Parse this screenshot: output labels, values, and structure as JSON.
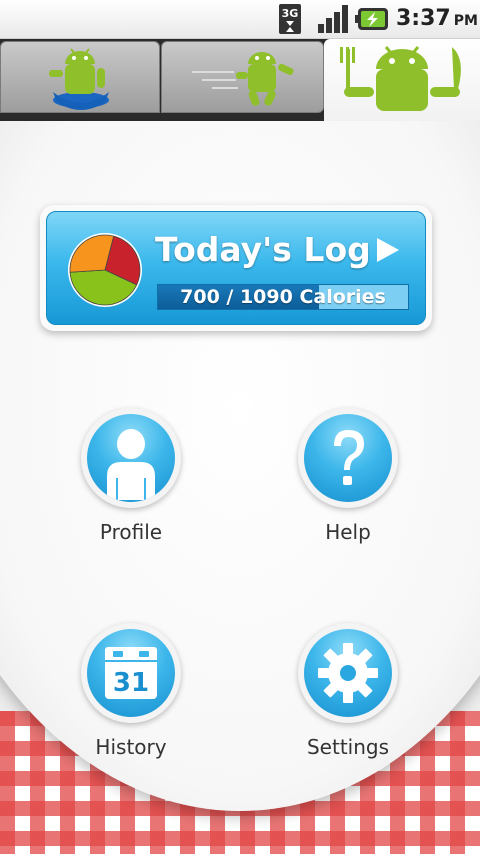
{
  "status_bar": {
    "network": "3G",
    "time": "3:37",
    "ampm": "PM"
  },
  "tabs": [
    {
      "name": "tab-weight",
      "icon": "android-on-scale-icon"
    },
    {
      "name": "tab-exercise",
      "icon": "android-running-icon"
    },
    {
      "name": "tab-food",
      "icon": "android-fork-knife-icon",
      "selected": true
    }
  ],
  "todays_log": {
    "title": "Today's Log",
    "calories_consumed": 700,
    "calories_goal": 1090,
    "calories_text": "700 / 1090 Calories",
    "pie_segments": [
      {
        "label": "red",
        "color": "#c8222c",
        "value": 0.28
      },
      {
        "label": "green",
        "color": "#8ac21c",
        "value": 0.42
      },
      {
        "label": "orange",
        "color": "#f7941d",
        "value": 0.3
      }
    ]
  },
  "menu": {
    "profile_label": "Profile",
    "help_label": "Help",
    "history_label": "History",
    "history_day": "31",
    "settings_label": "Settings"
  },
  "colors": {
    "accent_blue": "#1799d6",
    "tablecloth_red": "#e24646"
  }
}
